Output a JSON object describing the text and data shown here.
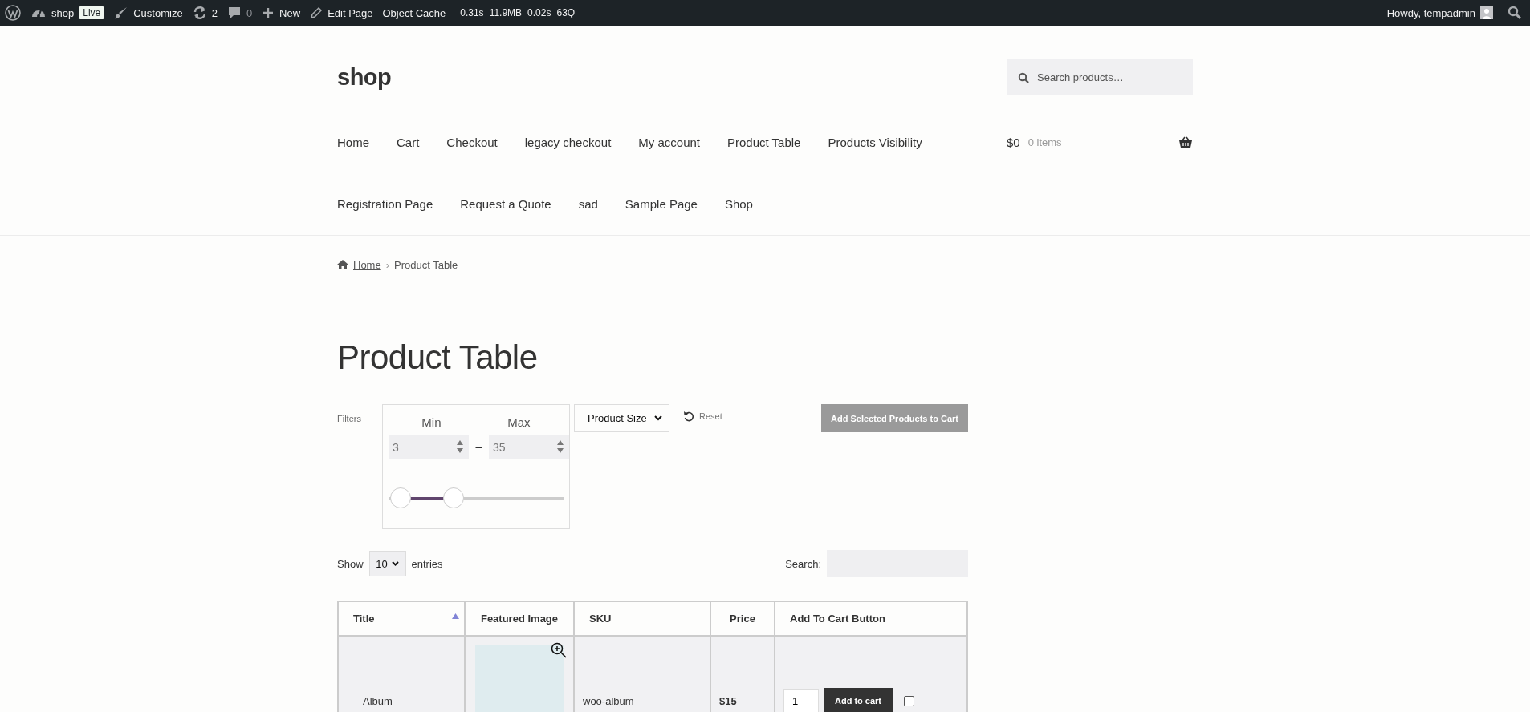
{
  "admin_bar": {
    "items": [
      {
        "kind": "logo"
      },
      {
        "kind": "site",
        "label": "shop",
        "badge": "Live"
      },
      {
        "kind": "customize",
        "label": "Customize"
      },
      {
        "kind": "updates",
        "label": "2"
      },
      {
        "kind": "comments",
        "label": "0"
      },
      {
        "kind": "new",
        "label": "New"
      },
      {
        "kind": "edit",
        "label": "Edit Page"
      },
      {
        "kind": "text",
        "label": "Object Cache"
      },
      {
        "kind": "stats",
        "values": [
          "0.31s",
          "11.9MB",
          "0.02s",
          "63Q"
        ]
      }
    ],
    "greeting": "Howdy, tempadmin"
  },
  "header": {
    "site_title": "shop",
    "search": {
      "placeholder": "Search products…"
    },
    "nav_rows": [
      {
        "items": [
          "Home",
          "Cart",
          "Checkout",
          "legacy checkout",
          "My account",
          "Product Table",
          "Products Visibility"
        ]
      },
      {
        "items": [
          "Registration Page",
          "Request a Quote",
          "sad",
          "Sample Page",
          "Shop"
        ]
      }
    ],
    "cart": {
      "amount": "$0",
      "count": "0 items"
    }
  },
  "breadcrumb": {
    "home": "Home",
    "separator": "›",
    "current": "Product Table"
  },
  "page_title": "Product Table",
  "filters": {
    "label": "Filters",
    "range": {
      "min_label": "Min",
      "max_label": "Max",
      "min_value": "3",
      "max_value": "35",
      "dash": "–",
      "thumbs": [
        {
          "level": 0.07
        },
        {
          "level": 0.37
        }
      ]
    },
    "select": "Product Size",
    "reset": "Reset",
    "add_selected": {
      "label": "Add Selected Products to Cart",
      "disabled": true
    }
  },
  "table_controls": {
    "show": "Show",
    "page_size": "10",
    "entries": "entries",
    "search_label": "Search:"
  },
  "table": {
    "columns": [
      {
        "label": "Title",
        "sorted": true
      },
      {
        "label": "Featured Image",
        "sorted": false
      },
      {
        "label": "SKU",
        "sorted": false
      },
      {
        "label": "Price",
        "sorted": false
      },
      {
        "label": "Add To Cart Button",
        "sorted": false
      }
    ],
    "rows": [
      {
        "title": "Album",
        "sku": "woo-album",
        "price": "$15",
        "quantity": "1",
        "button": "Add to cart",
        "checked": false
      }
    ]
  }
}
